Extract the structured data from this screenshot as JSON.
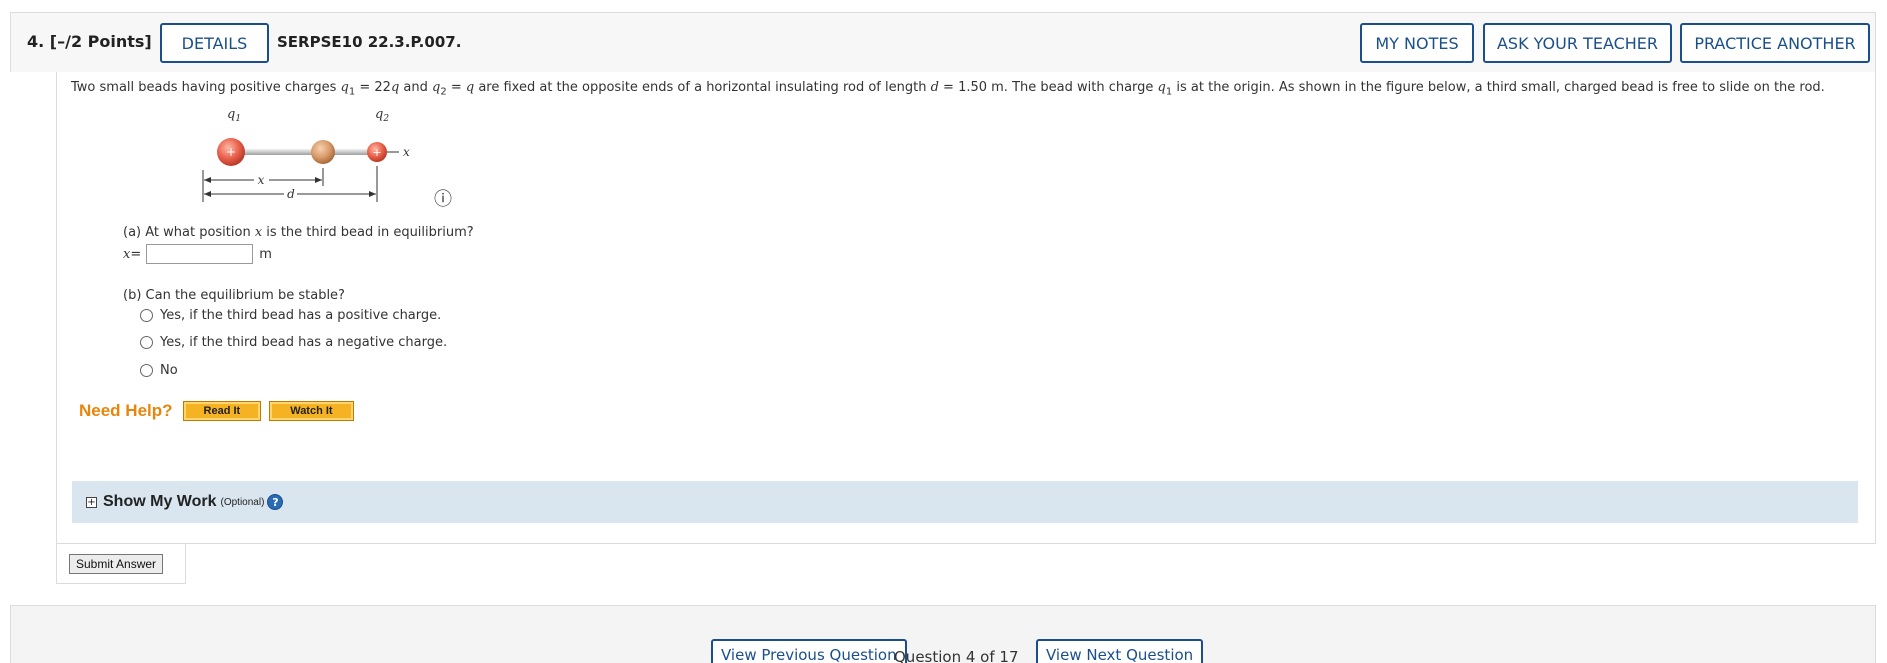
{
  "question": {
    "number": "4.",
    "points": "[–/2 Points]",
    "code": "SERPSE10 22.3.P.007.",
    "details_label": "DETAILS",
    "my_notes_label": "MY NOTES",
    "ask_teacher_label": "ASK YOUR TEACHER",
    "practice_another_label": "PRACTICE ANOTHER"
  },
  "problem": {
    "t1": "Two small beads having positive charges ",
    "q1_sym": "q",
    "q1_sub": "1",
    "t2": " = 22",
    "q_sym": "q",
    "t3": " and ",
    "q2_sym": "q",
    "q2_sub": "2",
    "t4": " = ",
    "q2_val": "q",
    "t5": " are fixed at the opposite ends of a horizontal insulating rod of length ",
    "d_sym": "d",
    "t6": " = 1.50 m. The bead with charge ",
    "q1b_sym": "q",
    "q1b_sub": "1",
    "t7": " is at the origin. As shown in the figure below, a third small, charged bead is free to slide on the rod."
  },
  "figure": {
    "q1_label": "q",
    "q1_label_sub": "1",
    "q2_label": "q",
    "q2_label_sub": "2",
    "plus_sign": "+",
    "x_axis_label": "x",
    "x_dim_label": "x",
    "d_dim_label": "d",
    "info_icon": "ⓘ"
  },
  "part_a": {
    "prefix": "(a) At what position ",
    "var": "x",
    "suffix": " is the third bead in equilibrium?",
    "input_label": "x",
    "input_eq": " =",
    "input_value": "",
    "unit": "m"
  },
  "part_b": {
    "prompt": "(b) Can the equilibrium be stable?",
    "options": [
      "Yes, if the third bead has a positive charge.",
      "Yes, if the third bead has a negative charge.",
      "No"
    ]
  },
  "help": {
    "label": "Need Help?",
    "read_it": "Read It",
    "watch_it": "Watch It"
  },
  "show_work": {
    "plus": "+",
    "title": "Show My Work",
    "optional": "(Optional)",
    "help_glyph": "?"
  },
  "submit_label": "Submit Answer",
  "nav": {
    "prev_label": "View Previous Question",
    "position_text": "Question 4 of 17",
    "next_label": "View Next Question"
  }
}
